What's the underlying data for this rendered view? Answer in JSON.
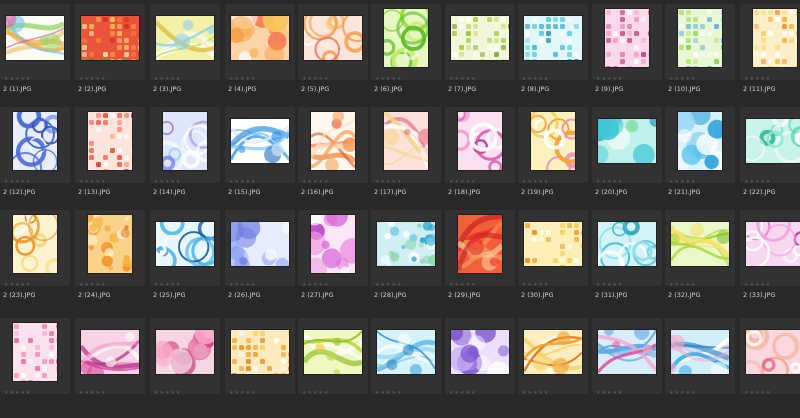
{
  "colors": {
    "background": "#282828",
    "cell": "#323232",
    "filename_text": "#d6d6d6",
    "star_empty": "#555555"
  },
  "rating_glyph": "★★★★★",
  "rating_icon": "star-icon",
  "thumbnails": [
    {
      "name": "2 (1).JPG",
      "orientation": "landscape",
      "base": "#fdfdf5",
      "accents": [
        "#6ec6e8",
        "#f1b04a",
        "#e85b9c",
        "#9bd66a"
      ],
      "pattern": "swirls"
    },
    {
      "name": "2 (2).JPG",
      "orientation": "landscape",
      "base": "#e9543b",
      "accents": [
        "#f7c65a",
        "#ff8a3d",
        "#f5e4a0",
        "#d62d20"
      ],
      "pattern": "grid"
    },
    {
      "name": "2 (3).JPG",
      "orientation": "landscape",
      "base": "#f3f0a8",
      "accents": [
        "#c7e06a",
        "#8fd0e8",
        "#ffffff",
        "#e0c24a"
      ],
      "pattern": "swirls"
    },
    {
      "name": "2 (4).JPG",
      "orientation": "landscape",
      "base": "#fcd4a6",
      "accents": [
        "#f59a3c",
        "#f26b4d",
        "#ffffff",
        "#f7c35a"
      ],
      "pattern": "circles"
    },
    {
      "name": "2 (5).JPG",
      "orientation": "landscape",
      "base": "#fbe6dc",
      "accents": [
        "#f26b5b",
        "#f89d48",
        "#ffffff",
        "#f7c76a"
      ],
      "pattern": "rings"
    },
    {
      "name": "2 (6).JPG",
      "orientation": "portrait",
      "base": "#e6f7c2",
      "accents": [
        "#8ed83a",
        "#5fbd2c",
        "#ffffff",
        "#c6ec6a"
      ],
      "pattern": "rings"
    },
    {
      "name": "2 (7).JPG",
      "orientation": "landscape",
      "base": "#f2f7dc",
      "accents": [
        "#9ac630",
        "#c9e06a",
        "#6a9e24",
        "#ffffff"
      ],
      "pattern": "grid"
    },
    {
      "name": "2 (8).JPG",
      "orientation": "landscape",
      "base": "#e4f7f8",
      "accents": [
        "#35b8cf",
        "#5ad0e0",
        "#ffffff",
        "#1f8fb0"
      ],
      "pattern": "grid"
    },
    {
      "name": "2 (9).JPG",
      "orientation": "portrait",
      "base": "#fbd9ea",
      "accents": [
        "#e8579a",
        "#f39ac2",
        "#ffffff",
        "#c03c7a"
      ],
      "pattern": "grid"
    },
    {
      "name": "2 (10).JPG",
      "orientation": "portrait",
      "base": "#eaf7d6",
      "accents": [
        "#8fd04a",
        "#5fb0d8",
        "#ffffff",
        "#b7e26a"
      ],
      "pattern": "grid"
    },
    {
      "name": "2 (11).JPG",
      "orientation": "portrait",
      "base": "#fdf0c8",
      "accents": [
        "#f5b030",
        "#f48a2a",
        "#ffffff",
        "#f7d56a"
      ],
      "pattern": "grid"
    },
    {
      "name": "2 (12).JPG",
      "orientation": "portrait",
      "base": "#e8ecfb",
      "accents": [
        "#4a6cd8",
        "#7f9af0",
        "#ffffff",
        "#2f4fb0"
      ],
      "pattern": "rings"
    },
    {
      "name": "2 (13).JPG",
      "orientation": "portrait",
      "base": "#fde4dc",
      "accents": [
        "#f2503a",
        "#f48a6a",
        "#ffffff",
        "#d6321f"
      ],
      "pattern": "grid"
    },
    {
      "name": "2 (14).JPG",
      "orientation": "portrait",
      "base": "#dfe6fb",
      "accents": [
        "#5b6ee0",
        "#8ad4e6",
        "#ffffff",
        "#a07ce6"
      ],
      "pattern": "rings"
    },
    {
      "name": "2 (15).JPG",
      "orientation": "landscape",
      "base": "#ffffff",
      "accents": [
        "#2f8fe0",
        "#7dc2f5",
        "#dfeffd",
        "#1f6cc0"
      ],
      "pattern": "swirls"
    },
    {
      "name": "2 (16).JPG",
      "orientation": "portrait",
      "base": "#fff7ee",
      "accents": [
        "#f07a2a",
        "#f5a35a",
        "#ffe0c0",
        "#e0501f"
      ],
      "pattern": "swirls"
    },
    {
      "name": "2 (17).JPG",
      "orientation": "portrait",
      "base": "#fde2dc",
      "accents": [
        "#f2a0a8",
        "#f6d38a",
        "#ffffff",
        "#e86a7a"
      ],
      "pattern": "swirls"
    },
    {
      "name": "2 (18).JPG",
      "orientation": "portrait",
      "base": "#fbe0f0",
      "accents": [
        "#d94aa8",
        "#b83f9c",
        "#ffffff",
        "#f089c9"
      ],
      "pattern": "rings"
    },
    {
      "name": "2 (19).JPG",
      "orientation": "portrait",
      "base": "#fdf2bd",
      "accents": [
        "#f2c43a",
        "#f18ab8",
        "#ffffff",
        "#f7a23a"
      ],
      "pattern": "rings"
    },
    {
      "name": "2 (20).JPG",
      "orientation": "landscape",
      "base": "#bff1ea",
      "accents": [
        "#3fc7d8",
        "#88e0a8",
        "#ffffff",
        "#2aa7c8"
      ],
      "pattern": "circles"
    },
    {
      "name": "2 (21).JPG",
      "orientation": "portrait",
      "base": "#d9f1fb",
      "accents": [
        "#58c2ee",
        "#9ad8f5",
        "#ffffff",
        "#2fa2da"
      ],
      "pattern": "circles"
    },
    {
      "name": "2 (22).JPG",
      "orientation": "landscape",
      "base": "#c9f3e8",
      "accents": [
        "#5ed6b6",
        "#8fe8d0",
        "#ffffff",
        "#2fb89a"
      ],
      "pattern": "rings"
    },
    {
      "name": "2 (23).JPG",
      "orientation": "portrait",
      "base": "#fdf3cf",
      "accents": [
        "#f3b23a",
        "#f7d46a",
        "#ffffff",
        "#e8902a"
      ],
      "pattern": "rings"
    },
    {
      "name": "2 (24).JPG",
      "orientation": "portrait",
      "base": "#fbd28a",
      "accents": [
        "#f28a1f",
        "#f5b03a",
        "#fff1c8",
        "#e06a1a"
      ],
      "pattern": "dots"
    },
    {
      "name": "2 (25).JPG",
      "orientation": "landscape",
      "base": "#e8f7fb",
      "accents": [
        "#1f7fc8",
        "#4ab4e6",
        "#ffffff",
        "#135a9e"
      ],
      "pattern": "rings"
    },
    {
      "name": "2 (26).JPG",
      "orientation": "landscape",
      "base": "#e6ecfb",
      "accents": [
        "#8aa2f0",
        "#b7c6f5",
        "#ffffff",
        "#6f7ee0"
      ],
      "pattern": "circles"
    },
    {
      "name": "2 (27).JPG",
      "orientation": "portrait",
      "base": "#fbe6f5",
      "accents": [
        "#d96ad9",
        "#ef9ae0",
        "#ffffff",
        "#b84ac4"
      ],
      "pattern": "circles"
    },
    {
      "name": "2 (28).JPG",
      "orientation": "landscape",
      "base": "#cfeff5",
      "accents": [
        "#2fa8d0",
        "#6cc8e2",
        "#ffffff",
        "#8ad8a8"
      ],
      "pattern": "dots"
    },
    {
      "name": "2 (29).JPG",
      "orientation": "portrait",
      "base": "#f2603a",
      "accents": [
        "#e8302a",
        "#f8a05a",
        "#ffd0a0",
        "#c81f1f"
      ],
      "pattern": "swirls"
    },
    {
      "name": "2 (30).JPG",
      "orientation": "landscape",
      "base": "#fdefb8",
      "accents": [
        "#f3a02a",
        "#f7c84a",
        "#ffffff",
        "#e88a1f"
      ],
      "pattern": "grid"
    },
    {
      "name": "2 (31).JPG",
      "orientation": "landscape",
      "base": "#d4f3f6",
      "accents": [
        "#3fc0d0",
        "#8ae0ea",
        "#ffffff",
        "#25a0b8"
      ],
      "pattern": "rings"
    },
    {
      "name": "2 (32).JPG",
      "orientation": "landscape",
      "base": "#eaf8c8",
      "accents": [
        "#a8d83a",
        "#f7e06a",
        "#ffffff",
        "#7fc02a"
      ],
      "pattern": "swirls"
    },
    {
      "name": "2 (33).JPG",
      "orientation": "landscape",
      "base": "#f8d8f0",
      "accents": [
        "#e063c4",
        "#f2a0dc",
        "#ffffff",
        "#b8409c"
      ],
      "pattern": "rings"
    },
    {
      "name": "",
      "orientation": "portrait",
      "base": "#fbe2ec",
      "accents": [
        "#f08ab0",
        "#f5b8d0",
        "#ffffff",
        "#e86a9a"
      ],
      "pattern": "grid"
    },
    {
      "name": "",
      "orientation": "landscape",
      "base": "#f8d3e6",
      "accents": [
        "#d9489c",
        "#f28ab8",
        "#ffffff",
        "#b33a8a"
      ],
      "pattern": "swirls"
    },
    {
      "name": "",
      "orientation": "landscape",
      "base": "#f7d6e4",
      "accents": [
        "#e05a96",
        "#f6a6c6",
        "#ffffff",
        "#c03a7a"
      ],
      "pattern": "circles"
    },
    {
      "name": "",
      "orientation": "landscape",
      "base": "#fdebbf",
      "accents": [
        "#f5a42a",
        "#f8cf5a",
        "#ffffff",
        "#e88a1a"
      ],
      "pattern": "grid"
    },
    {
      "name": "",
      "orientation": "landscape",
      "base": "#f0f7c0",
      "accents": [
        "#b8d83a",
        "#f5c83a",
        "#ffffff",
        "#8fc02a"
      ],
      "pattern": "swirls"
    },
    {
      "name": "",
      "orientation": "landscape",
      "base": "#d6f2fb",
      "accents": [
        "#3fa8e0",
        "#8ad0f0",
        "#ffffff",
        "#2f88c8"
      ],
      "pattern": "swirls"
    },
    {
      "name": "",
      "orientation": "landscape",
      "base": "#ecdffb",
      "accents": [
        "#a07ae6",
        "#c8b0f5",
        "#ffffff",
        "#7f58d0"
      ],
      "pattern": "circles"
    },
    {
      "name": "",
      "orientation": "landscape",
      "base": "#fdeec0",
      "accents": [
        "#f0a02a",
        "#f7d06a",
        "#ffffff",
        "#e8781a"
      ],
      "pattern": "swirls"
    },
    {
      "name": "",
      "orientation": "landscape",
      "base": "#d9ecfb",
      "accents": [
        "#e05aa8",
        "#f5a6d0",
        "#ffffff",
        "#5aa8e0"
      ],
      "pattern": "swirls"
    },
    {
      "name": "",
      "orientation": "landscape",
      "base": "#d2eefb",
      "accents": [
        "#3fb0e8",
        "#f5a6c8",
        "#ffffff",
        "#2f88c8"
      ],
      "pattern": "swirls"
    },
    {
      "name": "",
      "orientation": "landscape",
      "base": "#fbd8e0",
      "accents": [
        "#f08a6a",
        "#f5b8a0",
        "#ffffff",
        "#e05a7a"
      ],
      "pattern": "rings"
    }
  ]
}
